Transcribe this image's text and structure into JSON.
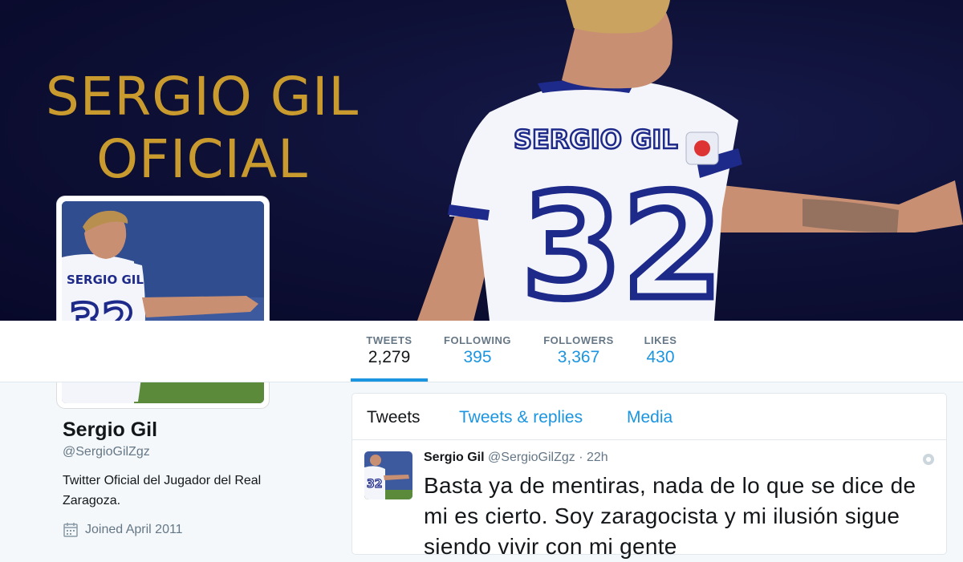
{
  "banner": {
    "title": "SERGIO GIL\nOFICIAL"
  },
  "nav": {
    "stats": [
      {
        "label": "TWEETS",
        "value": "2,279"
      },
      {
        "label": "FOLLOWING",
        "value": "395"
      },
      {
        "label": "FOLLOWERS",
        "value": "3,367"
      },
      {
        "label": "LIKES",
        "value": "430"
      }
    ],
    "active_index": 0
  },
  "profile": {
    "name": "Sergio Gil",
    "handle": "@SergioGilZgz",
    "bio": "Twitter Oficial del Jugador del Real Zaragoza.",
    "joined": "Joined April 2011",
    "joined_icon": "calendar-icon"
  },
  "timeline": {
    "tabs": [
      {
        "label": "Tweets"
      },
      {
        "label": "Tweets & replies"
      },
      {
        "label": "Media"
      }
    ],
    "active_tab": 0,
    "tweet": {
      "name": "Sergio Gil",
      "handle": "@SergioGilZgz",
      "separator": "·",
      "time": "22h",
      "text": "Basta ya de mentiras, nada de lo que se dice de mi es cierto. Soy zaragocista y mi ilusión sigue siendo vivir con mi gente",
      "menu_icon": "more-options-icon"
    }
  },
  "colors": {
    "accent": "#1b95e0",
    "banner_bg": "#0d0f34",
    "banner_title": "#c99a2e",
    "jersey_blue": "#1e2a8a"
  }
}
